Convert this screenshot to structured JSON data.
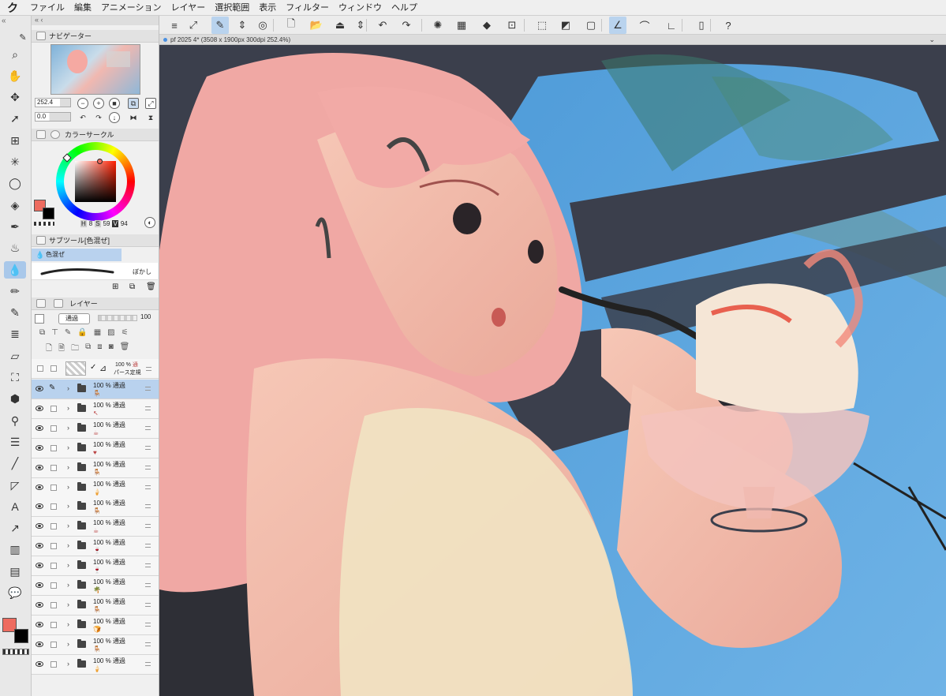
{
  "menubar": {
    "logo": "ク",
    "items": [
      "ファイル",
      "編集",
      "アニメーション",
      "レイヤー",
      "選択範囲",
      "表示",
      "フィルター",
      "ウィンドウ",
      "ヘルプ"
    ]
  },
  "commands": [
    {
      "name": "menu-icon",
      "glyph": "≡"
    },
    {
      "name": "fit-icon",
      "glyph": "⤢"
    },
    {
      "name": "brush-setting-icon",
      "glyph": "✎",
      "active": true
    },
    {
      "name": "stepper-icon",
      "glyph": "⇕"
    },
    {
      "name": "spiral-icon",
      "glyph": "◎"
    },
    {
      "name": "new-file-icon",
      "glyph": "🗋"
    },
    {
      "name": "open-folder-icon",
      "glyph": "📂"
    },
    {
      "name": "save-icon",
      "glyph": "⏏"
    },
    {
      "name": "stepper2-icon",
      "glyph": "⇕"
    },
    {
      "name": "undo-icon",
      "glyph": "↶"
    },
    {
      "name": "redo-icon",
      "glyph": "↷"
    },
    {
      "name": "loading-icon",
      "glyph": "✺"
    },
    {
      "name": "clear-icon",
      "glyph": "▦"
    },
    {
      "name": "fill-icon",
      "glyph": "◆"
    },
    {
      "name": "transform-icon",
      "glyph": "⊡"
    },
    {
      "name": "deselect-icon",
      "glyph": "⬚"
    },
    {
      "name": "invert-selection-icon",
      "glyph": "◩"
    },
    {
      "name": "selection-border-icon",
      "glyph": "▢"
    },
    {
      "name": "ruler-snap-icon",
      "glyph": "∠",
      "active": true
    },
    {
      "name": "special-ruler-icon",
      "glyph": "⌒"
    },
    {
      "name": "grid-snap-icon",
      "glyph": "∟"
    },
    {
      "name": "device-icon",
      "glyph": "▯"
    },
    {
      "name": "help-icon",
      "glyph": "?"
    }
  ],
  "tools": [
    {
      "name": "zoom-tool-icon",
      "glyph": "⌕"
    },
    {
      "name": "hand-tool-icon",
      "glyph": "✋"
    },
    {
      "name": "move-tool-icon",
      "glyph": "✥"
    },
    {
      "name": "object-tool-icon",
      "glyph": "➚"
    },
    {
      "name": "layer-move-tool-icon",
      "glyph": "⊞"
    },
    {
      "name": "auto-select-tool-icon",
      "glyph": "✳"
    },
    {
      "name": "lasso-tool-icon",
      "glyph": "◯"
    },
    {
      "name": "eraser-tool-icon",
      "glyph": "◈"
    },
    {
      "name": "pen-tool-icon",
      "glyph": "✒"
    },
    {
      "name": "airbrush-tool-icon",
      "glyph": "♨"
    },
    {
      "name": "blend-tool-icon",
      "glyph": "💧",
      "active": true
    },
    {
      "name": "pencil-tool-icon",
      "glyph": "✏"
    },
    {
      "name": "marker-tool-icon",
      "glyph": "✎"
    },
    {
      "name": "hatching-tool-icon",
      "glyph": "≣"
    },
    {
      "name": "eraser2-tool-icon",
      "glyph": "▱"
    },
    {
      "name": "decoration-tool-icon",
      "glyph": "⛶"
    },
    {
      "name": "fill-tool-icon",
      "glyph": "⬢"
    },
    {
      "name": "eyedropper-tool-icon",
      "glyph": "⚲"
    },
    {
      "name": "figure-tool-icon",
      "glyph": "☰"
    },
    {
      "name": "line-tool-icon",
      "glyph": "╱"
    },
    {
      "name": "frame-tool-icon",
      "glyph": "◸"
    },
    {
      "name": "text-tool-icon",
      "glyph": "A"
    },
    {
      "name": "balloon-tail-tool-icon",
      "glyph": "↗"
    },
    {
      "name": "gradient-tool-icon",
      "glyph": "▥"
    },
    {
      "name": "frame-border-tool-icon",
      "glyph": "▤"
    },
    {
      "name": "balloon-tool-icon",
      "glyph": "💬"
    }
  ],
  "navigator": {
    "title": "ナビゲーター",
    "zoom": "252.4",
    "rotation": "0.0"
  },
  "color_circle": {
    "title": "カラーサークル",
    "h_label": "H",
    "h": "8",
    "s_label": "S",
    "s": "59",
    "v_label": "V",
    "v": "94",
    "main_color": "#ee6b5f",
    "sub_color": "#000000"
  },
  "subtool": {
    "title": "サブツール[色混ぜ]",
    "group": "色混ぜ",
    "brush_name": "ぼかし"
  },
  "layers_panel": {
    "title": "レイヤー",
    "blend_mode": "通過",
    "opacity": "100",
    "paper_layer": {
      "opacity": "100 %",
      "mode": "通",
      "name": "パース定規"
    },
    "rows": [
      {
        "opacity": "100 % 通過",
        "mark": "🪑",
        "selected": true
      },
      {
        "opacity": "100 % 通過",
        "mark": "↖"
      },
      {
        "opacity": "100 % 通過",
        "mark": "☕"
      },
      {
        "opacity": "100 % 通過",
        "mark": "♥"
      },
      {
        "opacity": "100 % 通過",
        "mark": "🪑"
      },
      {
        "opacity": "100 % 通過",
        "mark": "🍦"
      },
      {
        "opacity": "100 % 通過",
        "mark": "🪑"
      },
      {
        "opacity": "100 % 通過",
        "mark": "☕"
      },
      {
        "opacity": "100 % 通過",
        "mark": "🍷"
      },
      {
        "opacity": "100 % 通過",
        "mark": "🍷"
      },
      {
        "opacity": "100 % 通過",
        "mark": "🌴"
      },
      {
        "opacity": "100 % 通過",
        "mark": "🪑"
      },
      {
        "opacity": "100 % 通過",
        "mark": "🍞"
      },
      {
        "opacity": "100 % 通過",
        "mark": "🪑"
      },
      {
        "opacity": "100 % 通過",
        "mark": "🍦"
      }
    ]
  },
  "canvas": {
    "tab_label": "pf 2025 4* (3508 x 1900px 300dpi 252.4%)"
  },
  "bottom_colors": {
    "main": "#ee6b5f",
    "sub": "#000000"
  }
}
